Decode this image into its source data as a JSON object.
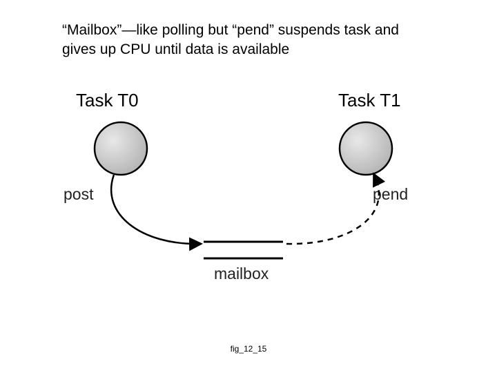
{
  "caption": "“Mailbox”—like polling but “pend” suspends task and gives up CPU until data is available",
  "diagram": {
    "task0_label": "Task T0",
    "task1_label": "Task T1",
    "post_label": "post",
    "pend_label": "pend",
    "mailbox_label": "mailbox"
  },
  "figure_id": "fig_12_15",
  "colors": {
    "node_fill": "#cfcfcf",
    "node_stroke": "#000",
    "line": "#000"
  }
}
